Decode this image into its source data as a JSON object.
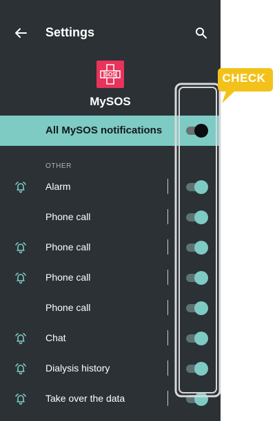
{
  "header": {
    "title": "Settings",
    "back_icon": "arrow-left-icon",
    "search_icon": "search-icon"
  },
  "app": {
    "name": "MySOS",
    "logo_text": "SOS",
    "logo_color": "#e8335b"
  },
  "master_toggle": {
    "label": "All MySOS notifications",
    "state": "on"
  },
  "section": {
    "title": "OTHER"
  },
  "items": [
    {
      "label": "Alarm",
      "has_bell": true,
      "enabled": true
    },
    {
      "label": "Phone call",
      "has_bell": false,
      "enabled": true
    },
    {
      "label": "Phone call",
      "has_bell": true,
      "enabled": true
    },
    {
      "label": "Phone call",
      "has_bell": true,
      "enabled": true
    },
    {
      "label": "Phone call",
      "has_bell": false,
      "enabled": true
    },
    {
      "label": "Chat",
      "has_bell": true,
      "enabled": true
    },
    {
      "label": "Dialysis history",
      "has_bell": true,
      "enabled": true
    },
    {
      "label": "Take over the data",
      "has_bell": true,
      "enabled": true
    }
  ],
  "annotation": {
    "text": "CHECK",
    "bubble_color": "#f2c21b",
    "highlight_color": "#d9d9d9"
  },
  "colors": {
    "background": "#2b3135",
    "accent": "#7ecbc4",
    "text": "#ffffff"
  }
}
